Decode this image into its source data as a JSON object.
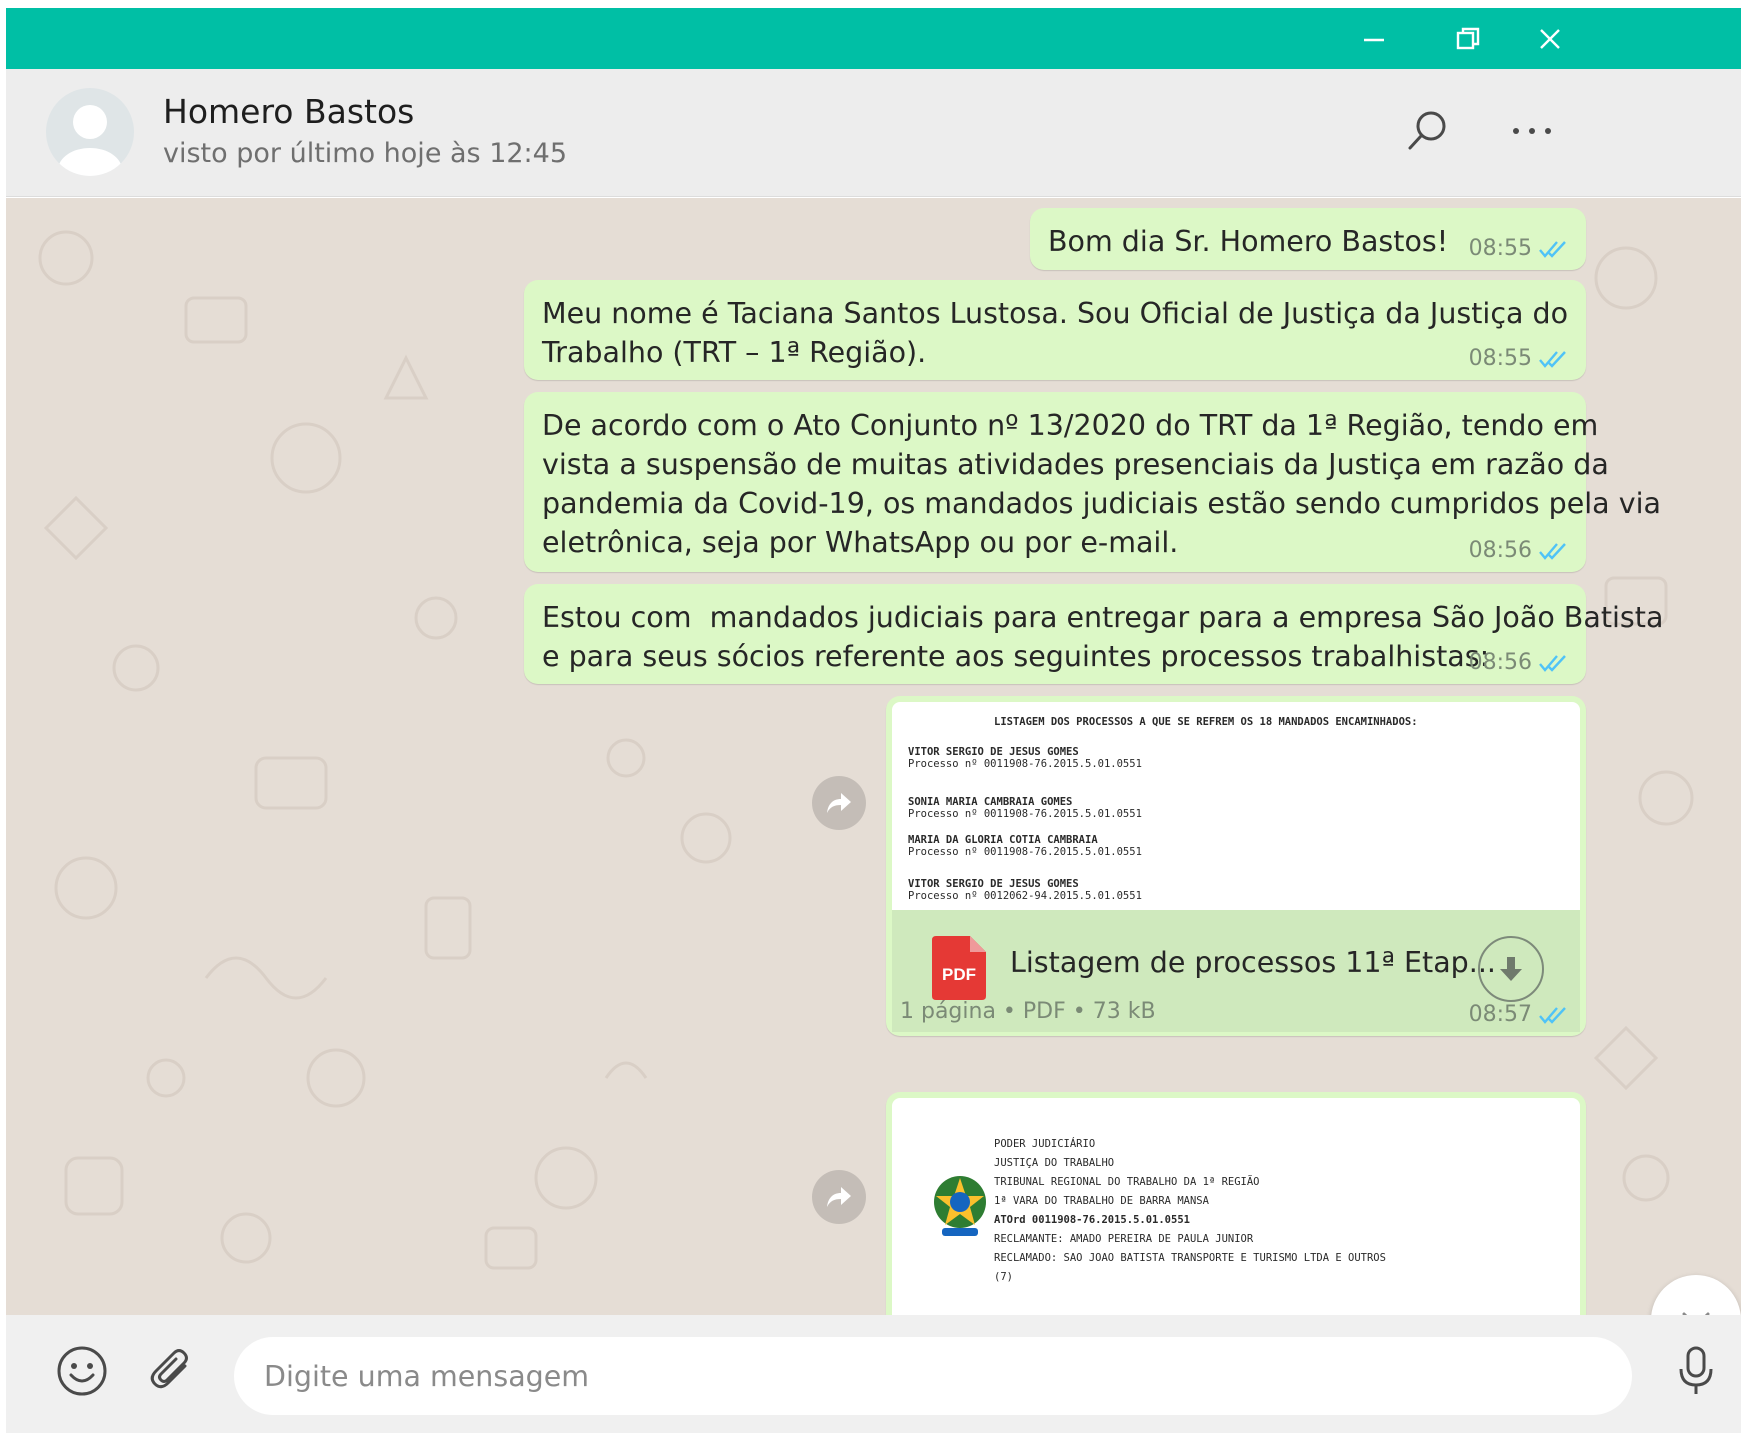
{
  "window": {
    "controls": [
      "minimize-icon",
      "restore-icon",
      "close-icon"
    ],
    "accent_color": "#00bfa5"
  },
  "contact": {
    "name": "Homero Bastos",
    "status": "visto por último hoje às 12:45"
  },
  "header_icons": [
    "search-icon",
    "menu-icon"
  ],
  "messages": [
    {
      "text": "Bom dia Sr. Homero Bastos!",
      "time": "08:55",
      "read": true
    },
    {
      "text": "Meu nome é Taciana Santos Lustosa. Sou Oficial de Justiça da Justiça do\nTrabalho (TRT – 1ª Região).",
      "time": "08:55",
      "read": true
    },
    {
      "text": "De acordo com o Ato Conjunto nº 13/2020 do TRT da 1ª Região, tendo em\nvista a suspensão de muitas atividades presenciais da Justiça em razão da\npandemia da Covid-19, os mandados judiciais estão sendo cumpridos pela via\neletrônica, seja por WhatsApp ou por e-mail.",
      "time": "08:56",
      "read": true
    },
    {
      "text": "Estou com  mandados judiciais para entregar para a empresa São João Batista\ne para seus sócios referente aos seguintes processos trabalhistas:",
      "time": "08:56",
      "read": true
    }
  ],
  "document1": {
    "preview_title": "LISTAGEM DOS PROCESSOS A QUE SE REFREM OS 18 MANDADOS ENCAMINHADOS:",
    "preview_lines": [
      "VITOR SERGIO DE JESUS GOMES",
      "Processo nº 0011908-76.2015.5.01.0551",
      "SONIA MARIA CAMBRAIA GOMES",
      "Processo nº 0011908-76.2015.5.01.0551",
      "MARIA DA GLORIA COTIA CAMBRAIA",
      "Processo nº 0011908-76.2015.5.01.0551",
      "VITOR SERGIO DE JESUS GOMES",
      "Processo nº 0012062-94.2015.5.01.0551"
    ],
    "file_badge": "PDF",
    "file_name": "Listagem de processos 11ª Etap...",
    "info": "1 página • PDF • 73 kB",
    "time": "08:57",
    "read": true
  },
  "document2": {
    "preview_lines": [
      "PODER JUDICIÁRIO",
      "JUSTIÇA DO TRABALHO",
      "TRIBUNAL REGIONAL DO TRABALHO DA 1ª REGIÃO",
      "1ª VARA DO TRABALHO DE BARRA MANSA",
      "ATOrd 0011908-76.2015.5.01.0551",
      "RECLAMANTE: AMADO PEREIRA DE PAULA JUNIOR",
      "RECLAMADO: SAO JOAO BATISTA TRANSPORTE E TURISMO LTDA E OUTROS",
      "(7)"
    ]
  },
  "composer": {
    "placeholder": "Digite uma mensagem",
    "icons": [
      "emoji-icon",
      "paperclip-icon",
      "microphone-icon"
    ]
  },
  "colors": {
    "outgoing_bubble": "#dcf8c6",
    "chat_background": "#e5ddd5",
    "read_tick": "#4fc3f7"
  }
}
